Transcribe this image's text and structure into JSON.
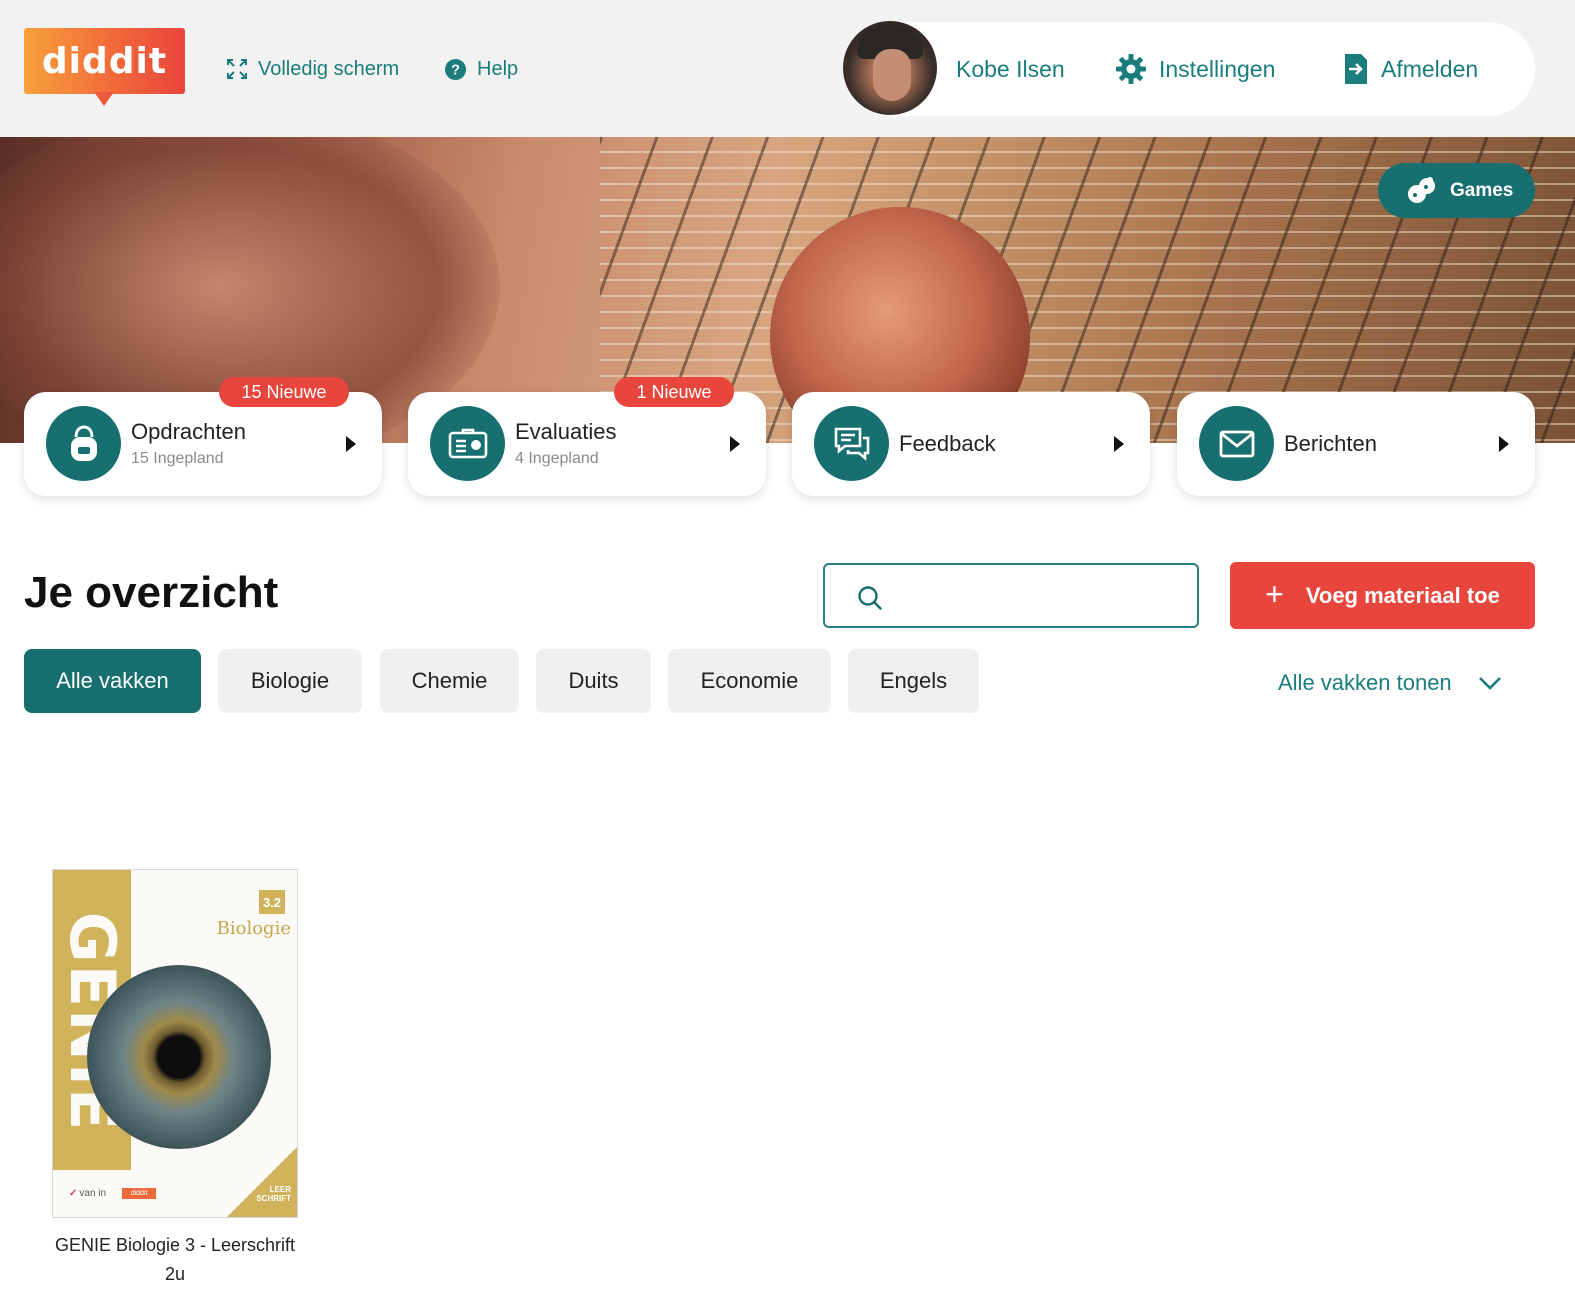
{
  "brand": {
    "logo_text": "diddit",
    "accent": "#176f6f",
    "alert": "#e8453d"
  },
  "topbar": {
    "fullscreen_label": "Volledig scherm",
    "help_label": "Help",
    "user_name": "Kobe Ilsen",
    "settings_label": "Instellingen",
    "logout_label": "Afmelden"
  },
  "hero": {
    "games_label": "Games"
  },
  "cards": [
    {
      "title": "Opdrachten",
      "subtitle": "15 Ingepland",
      "badge": "15 Nieuwe",
      "icon": "backpack-icon"
    },
    {
      "title": "Evaluaties",
      "subtitle": "4 Ingepland",
      "badge": "1 Nieuwe",
      "icon": "evaluation-icon"
    },
    {
      "title": "Feedback",
      "icon": "feedback-icon"
    },
    {
      "title": "Berichten",
      "icon": "envelope-icon"
    }
  ],
  "overview": {
    "title": "Je overzicht",
    "search_value": "",
    "search_placeholder": "",
    "add_material_label": "Voeg materiaal toe",
    "add_material_symbol": "+",
    "show_all_label": "Alle vakken tonen"
  },
  "subjects": [
    "Alle vakken",
    "Biologie",
    "Chemie",
    "Duits",
    "Economie",
    "Engels"
  ],
  "active_subject": "Alle vakken",
  "materials": [
    {
      "title_line1": "GENIE Biologie 3 - Leerschrift",
      "title_line2": "2u",
      "cover": {
        "series": "GENIE",
        "subject": "Biologie",
        "volume": "3.2",
        "type_line1": "LEER",
        "type_line2": "SCHRIFT",
        "publisher": "van in",
        "platform": "diddit"
      }
    }
  ]
}
